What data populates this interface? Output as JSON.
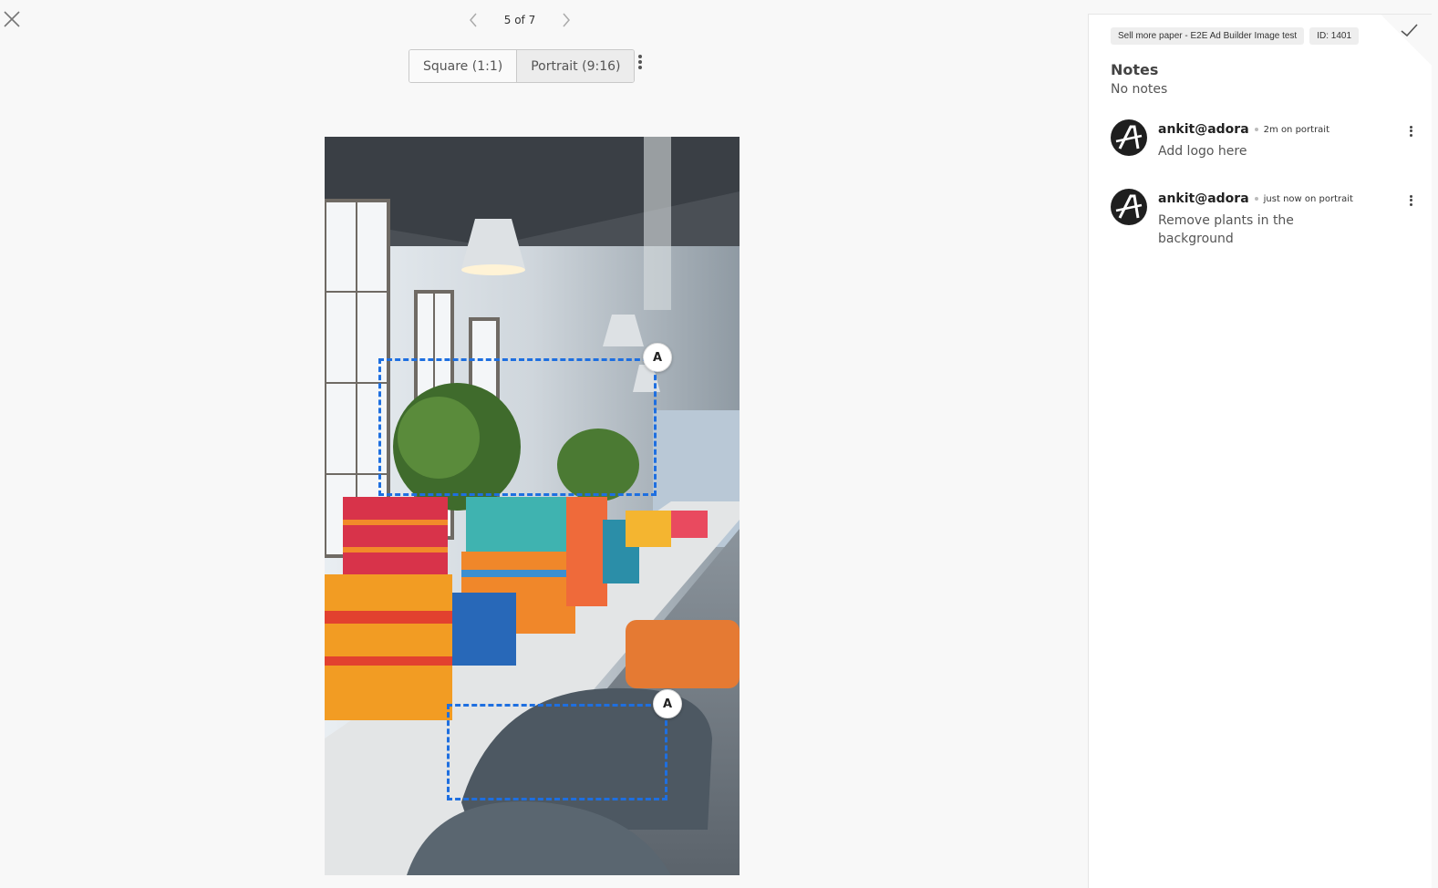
{
  "pager": {
    "text": "5 of 7",
    "prev_icon": "chevron-left-icon",
    "next_icon": "chevron-right-icon"
  },
  "ratios": [
    {
      "label": "Square (1:1)",
      "active": false
    },
    {
      "label": "Portrait (9:16)",
      "active": true
    }
  ],
  "annotations": [
    {
      "pin": "A"
    },
    {
      "pin": "A"
    }
  ],
  "panel": {
    "tags": [
      "Sell more paper - E2E Ad Builder Image test",
      "ID: 1401"
    ],
    "notes_title": "Notes",
    "notes_empty": "No notes",
    "comments": [
      {
        "user": "ankit@adora",
        "meta": "2m on portrait",
        "text": "Add logo here"
      },
      {
        "user": "ankit@adora",
        "meta": "just now on portrait",
        "text": "Remove plants in the background"
      }
    ]
  },
  "colors": {
    "accent": "#1e6fe0",
    "avatar": "#1f1f1f"
  }
}
